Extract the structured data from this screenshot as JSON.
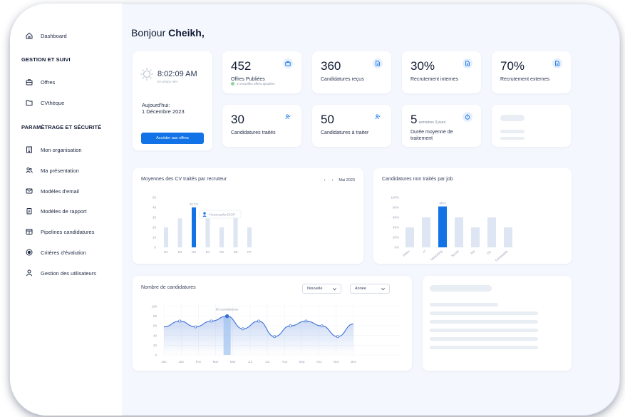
{
  "sidebar": {
    "items": [
      {
        "label": "Dashboard",
        "icon": "home-icon"
      },
      {
        "label": "Offres",
        "icon": "briefcase-icon"
      },
      {
        "label": "CVthèque",
        "icon": "folder-icon"
      },
      {
        "label": "Mon organisation",
        "icon": "building-icon"
      },
      {
        "label": "Ma présentation",
        "icon": "users-icon"
      },
      {
        "label": "Modèles d'email",
        "icon": "mail-icon"
      },
      {
        "label": "Modèles de rapport",
        "icon": "clipboard-icon"
      },
      {
        "label": "Pipelines candidatures",
        "icon": "pipeline-icon"
      },
      {
        "label": "Critères d'évalution",
        "icon": "radio-icon"
      },
      {
        "label": "Gestion des utilisateurs",
        "icon": "user-icon"
      }
    ],
    "sections": [
      "GESTION ET SUIVI",
      "PARAMÈTRAGE ET SÉCURITÉ"
    ]
  },
  "header": {
    "greeting": "Bonjour",
    "name": "Cheikh,"
  },
  "clock": {
    "time": "8:02:09 AM",
    "realtime": "En temps réel",
    "today_label": "Aujourd'hui:",
    "date": "1 Décembre 2023",
    "button": "Accéder aux offres"
  },
  "stats": [
    {
      "value": "452",
      "label": "Offres Publiées",
      "note": "3 nouvelles offres ajoutées",
      "icon": "briefcase-icon"
    },
    {
      "value": "360",
      "label": "Candidatures reçus",
      "icon": "document-icon"
    },
    {
      "value": "30%",
      "label": "Recrutement internes",
      "icon": "document-icon"
    },
    {
      "value": "70%",
      "label": "Recrutement externes",
      "icon": "document-icon"
    },
    {
      "value": "30",
      "label": "Candidatures traités",
      "icon": "user-check-icon"
    },
    {
      "value": "50",
      "label": "Candidatures à traiter",
      "icon": "user-check-icon"
    },
    {
      "value": "5",
      "unit": "semaines 3 jours",
      "label": "Durée moyenne de traitement",
      "icon": "timer-icon"
    }
  ],
  "colors": {
    "accent": "#1273e6",
    "bar_light": "#dde6f2",
    "line": "#3a6fd6",
    "sidebar_bg": "#ffffff",
    "page_bg": "#f4f7fd"
  },
  "chart_data": [
    {
      "type": "bar",
      "title": "Moyennes des CV traités par recruteur",
      "period": "Mai 2023",
      "categories": [
        "R1",
        "R2",
        "R3",
        "R4",
        "R5",
        "R6",
        "R7"
      ],
      "values": [
        20,
        29,
        40,
        29,
        20,
        30,
        20
      ],
      "highlight_index": 2,
      "highlight_label": "40 CV",
      "tooltip": "Youssoupha DIOP",
      "y_ticks": [
        "0",
        "10",
        "20",
        "30",
        "40",
        "50"
      ],
      "ylim": [
        0,
        50
      ]
    },
    {
      "type": "bar",
      "title": "Candidatures non traités par job",
      "categories": [
        "Sales",
        "IT",
        "Marketing",
        "Social",
        "RH",
        "Dir.",
        "Comptable"
      ],
      "values": [
        40,
        60,
        82,
        60,
        40,
        60,
        40
      ],
      "highlight_index": 2,
      "highlight_label": "86%",
      "y_ticks": [
        "0%",
        "20%",
        "40%",
        "60%",
        "80%",
        "100%"
      ],
      "ylim": [
        0,
        100
      ]
    },
    {
      "type": "line",
      "title": "Nombre de candidatures",
      "filters": [
        "Nouvelle",
        "Année"
      ],
      "x": [
        "Jan",
        "Jan",
        "Fev",
        "Mar",
        "Mar",
        "Jui",
        "Jui",
        "Aou",
        "Sep",
        "Oct",
        "Nov",
        "Dec"
      ],
      "values": [
        58,
        70,
        58,
        70,
        80,
        54,
        70,
        38,
        60,
        70,
        60,
        38,
        64
      ],
      "highlight_index": 4,
      "highlight_label": "80 candidatures",
      "y_ticks": [
        "0",
        "20",
        "40",
        "60",
        "80",
        "100"
      ],
      "ylim": [
        0,
        100
      ]
    }
  ]
}
